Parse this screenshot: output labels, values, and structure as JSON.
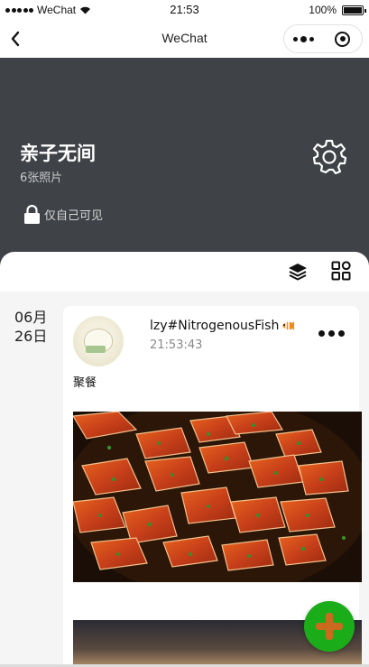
{
  "status_bar": {
    "carrier": "WeChat",
    "time": "21:53",
    "battery": "100%"
  },
  "nav": {
    "title": "WeChat"
  },
  "album": {
    "title": "亲子无间",
    "photo_count": "6张照片",
    "privacy": "仅自己可见"
  },
  "post": {
    "date_month": "06月",
    "date_day": "26日",
    "username": "lzy#NitrogenousFish",
    "time": "21:53:43",
    "caption": "聚餐"
  },
  "icons": {
    "back": "chevron-left-icon",
    "settings": "gear-icon",
    "lock": "lock-icon",
    "layers": "layers-icon",
    "grid": "grid-icon",
    "fab": "plus-icon"
  },
  "colors": {
    "header_bg": "#3f4246",
    "fab_bg": "#1aad19",
    "fab_plus": "#c96a1e"
  }
}
